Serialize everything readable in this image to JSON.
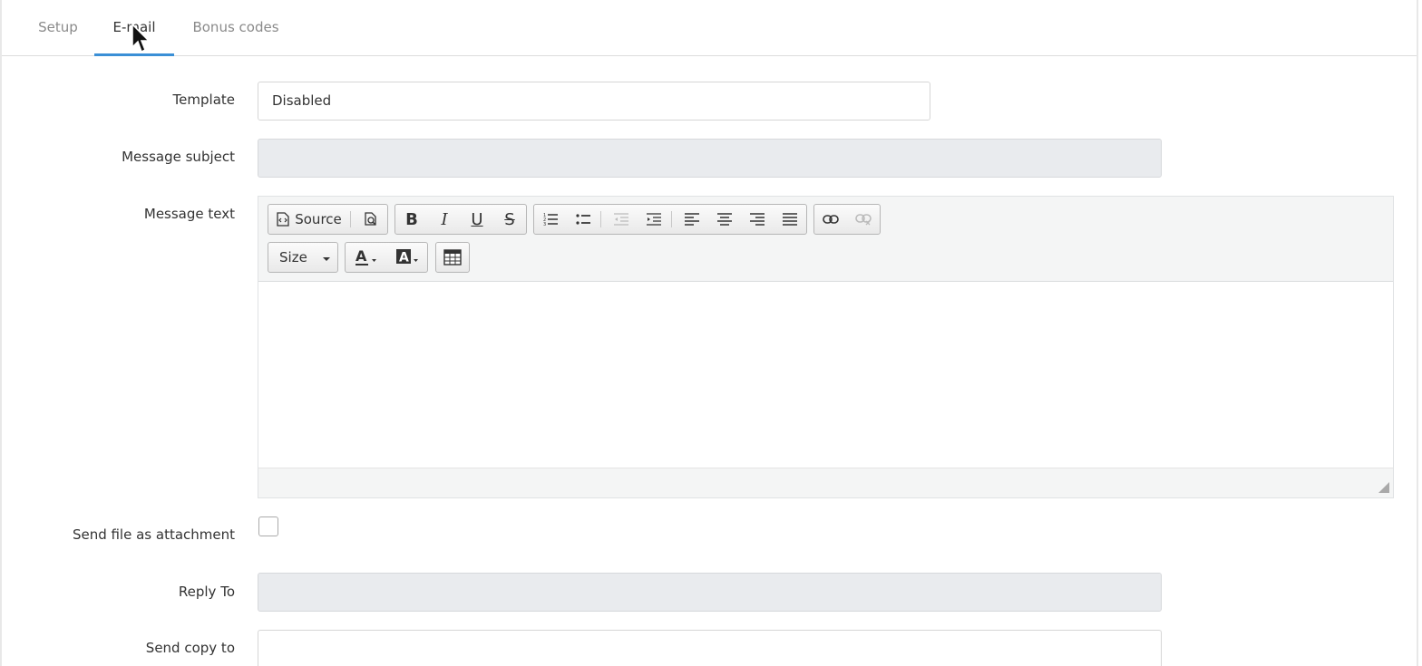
{
  "tabs": [
    {
      "label": "Setup",
      "active": false
    },
    {
      "label": "E-mail",
      "active": true
    },
    {
      "label": "Bonus codes",
      "active": false
    }
  ],
  "form": {
    "template": {
      "label": "Template",
      "value": "Disabled"
    },
    "message_subject": {
      "label": "Message subject",
      "value": ""
    },
    "message_text": {
      "label": "Message text"
    },
    "send_file_as_attachment": {
      "label": "Send file as attachment",
      "checked": false
    },
    "reply_to": {
      "label": "Reply To",
      "value": ""
    },
    "send_copy_to": {
      "label": "Send copy to",
      "value": ""
    }
  },
  "editor": {
    "source_label": "Source",
    "size_label": "Size",
    "icons": [
      "source-icon",
      "preview-icon",
      "bold-icon",
      "italic-icon",
      "underline-icon",
      "strikethrough-icon",
      "numbered-list-icon",
      "bulleted-list-icon",
      "outdent-icon",
      "indent-icon",
      "align-left-icon",
      "align-center-icon",
      "align-right-icon",
      "justify-icon",
      "link-icon",
      "unlink-icon",
      "text-color-icon",
      "background-color-icon",
      "table-icon"
    ]
  },
  "colors": {
    "accent": "#3a8fd6",
    "disabled_field": "#e9ebee"
  }
}
